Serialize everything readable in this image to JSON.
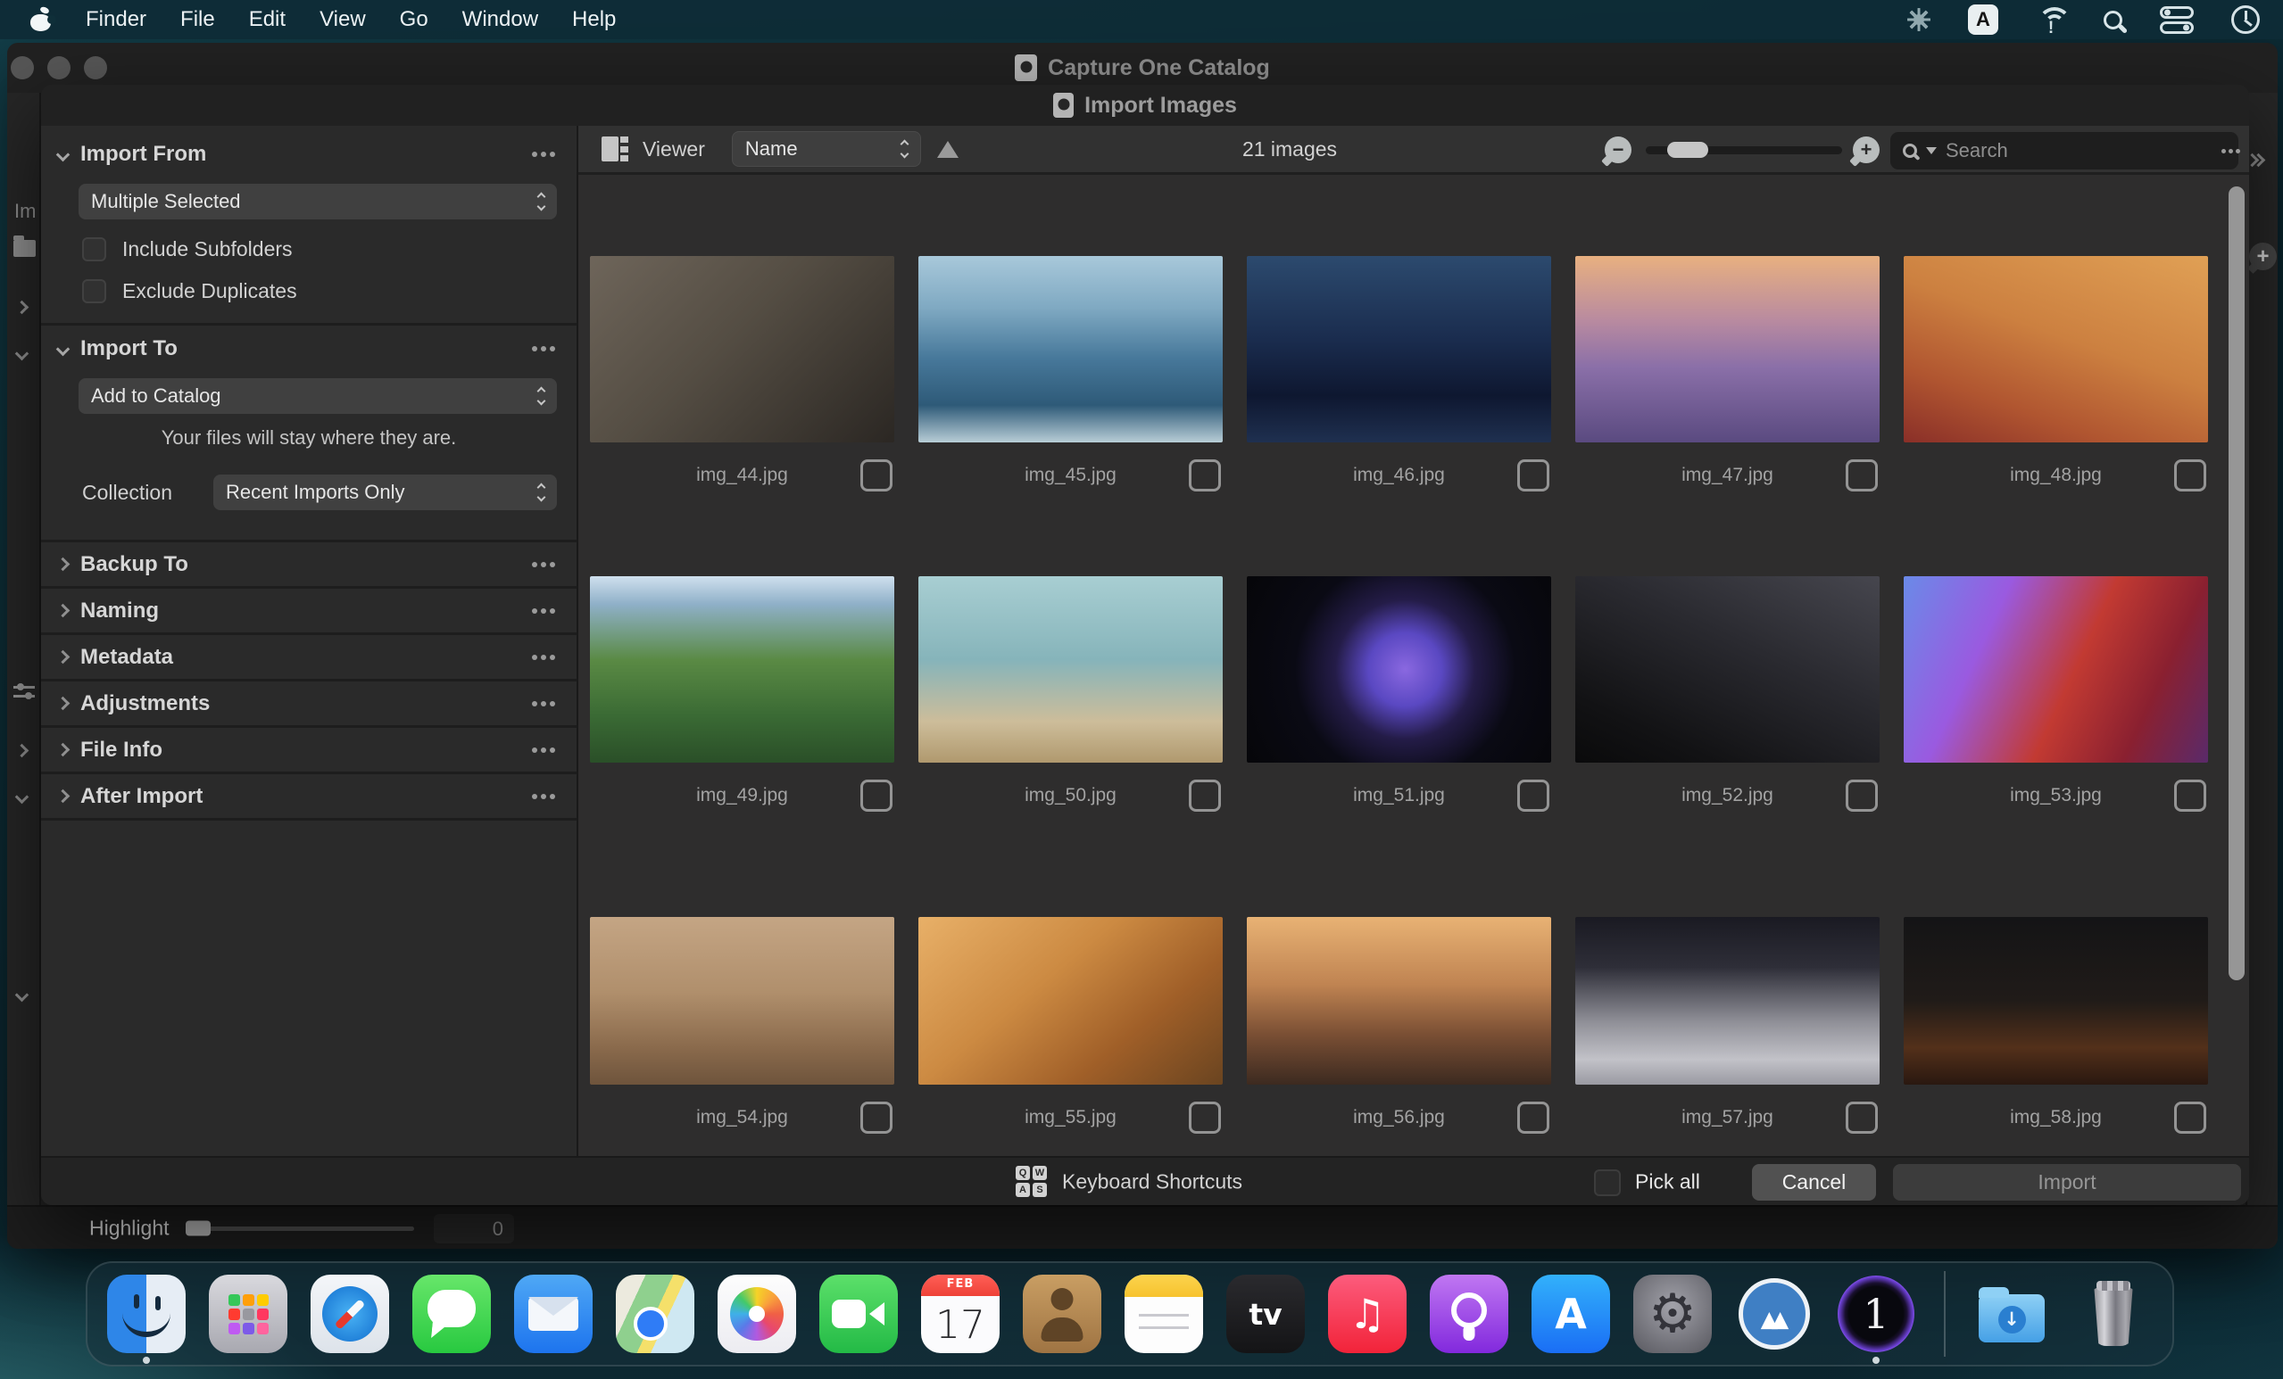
{
  "menu_bar": {
    "menus": [
      "Finder",
      "File",
      "Edit",
      "View",
      "Go",
      "Window",
      "Help"
    ],
    "input_source": "A"
  },
  "background_window": {
    "title": "Capture One Catalog",
    "clipped_label": "Im",
    "highlight": {
      "label": "Highlight",
      "value": "0"
    }
  },
  "dialog": {
    "title": "Import Images",
    "sidebar": {
      "import_from": {
        "title": "Import From",
        "source": "Multiple Selected",
        "options": [
          "Include Subfolders",
          "Exclude Duplicates"
        ]
      },
      "import_to": {
        "title": "Import To",
        "destination": "Add to Catalog",
        "note": "Your files will stay where they are.",
        "collection_label": "Collection",
        "collection": "Recent Imports Only"
      },
      "sections": [
        "Backup To",
        "Naming",
        "Metadata",
        "Adjustments",
        "File Info",
        "After Import"
      ]
    },
    "toolbar": {
      "viewer_label": "Viewer",
      "sort_by": "Name",
      "count": "21 images",
      "search_placeholder": "Search"
    },
    "grid": {
      "rows": [
        {
          "items": [
            {
              "filename": "img_44.jpg",
              "style": "background:linear-gradient(135deg,#6e655a 0%,#544d43 45%,#2b2723 100%)"
            },
            {
              "filename": "img_45.jpg",
              "style": "background:linear-gradient(180deg,#a8c8da 0%,#7fa9c2 28%,#47789a 55%,#2e5a78 80%,#b8cdd6 100%)"
            },
            {
              "filename": "img_46.jpg",
              "style": "background:linear-gradient(180deg,#2c4a6e 0%,#1a2c4e 45%,#0e1730 75%,#1f3050 100%)"
            },
            {
              "filename": "img_47.jpg",
              "style": "background:linear-gradient(180deg,#e8b080 0%,#b88aa0 35%,#8a6fa8 60%,#5a4a80 100%)"
            },
            {
              "filename": "img_48.jpg",
              "style": "background:linear-gradient(200deg,#e0a055 0%,#cc8040 45%,#b05530 75%,#8a2f28 100%)"
            }
          ]
        },
        {
          "items": [
            {
              "filename": "img_49.jpg",
              "style": "background:linear-gradient(180deg,#cfe0ee 0%,#8fb0c8 15%,#5a8a44 45%,#3a6a34 75%,#2a4f28 100%)"
            },
            {
              "filename": "img_50.jpg",
              "style": "background:linear-gradient(180deg,#a8ced2 0%,#86b4ba 45%,#cdbd9a 78%,#b0996e 100%)"
            },
            {
              "filename": "img_51.jpg",
              "style": "background:radial-gradient(circle at 52% 50%,#8a68e0 0%,#5a48c2 20%,#241c48 38%,#0a0a14 60%,#060609 100%)"
            },
            {
              "filename": "img_52.jpg",
              "style": "background:linear-gradient(205deg,#46464e 0%,#2a2a30 40%,#121214 80%,#0a0a0b 100%)"
            },
            {
              "filename": "img_53.jpg",
              "style": "background:linear-gradient(115deg,#6a8ae8 0%,#9a5ae0 28%,#c23a32 55%,#8a2030 78%,#5a2a6a 100%)"
            }
          ]
        },
        {
          "items": [
            {
              "filename": "img_54.jpg",
              "style": "background:linear-gradient(180deg,#c4a584 0%,#b08f6c 45%,#8a6a4c 78%,#6e543c 100%)"
            },
            {
              "filename": "img_55.jpg",
              "style": "background:linear-gradient(140deg,#e8b068 0%,#cc8a42 40%,#a05f28 70%,#6a4420 100%)"
            },
            {
              "filename": "img_56.jpg",
              "style": "background:linear-gradient(180deg,#e8b274 0%,#c08452 40%,#7a4f34 70%,#3c2a20 100%)"
            },
            {
              "filename": "img_57.jpg",
              "style": "background:linear-gradient(180deg,#1a1a22 0%,#2e2e38 30%,#8e8e96 62%,#c2c2c8 85%,#9a9aa2 100%)"
            },
            {
              "filename": "img_58.jpg",
              "style": "background:linear-gradient(180deg,#141416 0%,#201b18 50%,#53301a 78%,#2a1810 100%)"
            }
          ]
        }
      ]
    },
    "footer": {
      "shortcuts_label": "Keyboard Shortcuts",
      "shortcut_keys": [
        "Q",
        "W",
        "A",
        "S"
      ],
      "pick_all_label": "Pick all",
      "cancel_label": "Cancel",
      "import_label": "Import"
    }
  },
  "dock": {
    "items": [
      {
        "kind": "finder",
        "name": "Finder",
        "running": true
      },
      {
        "kind": "launchpad",
        "name": "Launchpad"
      },
      {
        "kind": "safari",
        "name": "Safari"
      },
      {
        "kind": "messages",
        "name": "Messages"
      },
      {
        "kind": "mail",
        "name": "Mail"
      },
      {
        "kind": "maps",
        "name": "Maps"
      },
      {
        "kind": "photos",
        "name": "Photos"
      },
      {
        "kind": "facetime",
        "name": "FaceTime"
      },
      {
        "kind": "calendar",
        "name": "Calendar",
        "top": "FEB",
        "label": "17"
      },
      {
        "kind": "contacts",
        "name": "Contacts"
      },
      {
        "kind": "notes",
        "name": "Notes"
      },
      {
        "kind": "appletv",
        "name": "Apple TV",
        "label": "tv"
      },
      {
        "kind": "music",
        "name": "Music",
        "label": "♫"
      },
      {
        "kind": "podcasts",
        "name": "Podcasts"
      },
      {
        "kind": "appstore",
        "name": "App Store",
        "label": "A"
      },
      {
        "kind": "settings",
        "name": "System Settings"
      },
      {
        "kind": "mountain",
        "name": "Mountain App",
        "label": "▲▲"
      },
      {
        "kind": "captureone",
        "name": "Capture One",
        "label": "1",
        "running": true
      },
      {
        "kind": "separator",
        "name": "separator",
        "inter": "false"
      },
      {
        "kind": "downloads",
        "name": "Downloads",
        "label": "↓"
      },
      {
        "kind": "trash",
        "name": "Trash"
      }
    ]
  }
}
